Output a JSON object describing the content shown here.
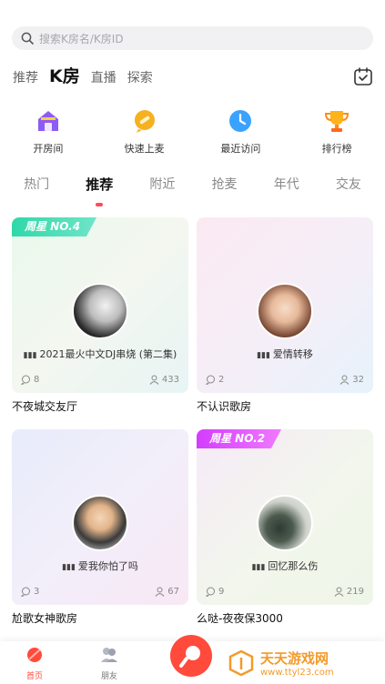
{
  "search": {
    "placeholder": "搜索K房名/K房ID"
  },
  "top_tabs": [
    "推荐",
    "K房",
    "直播",
    "探索"
  ],
  "quick_actions": [
    {
      "label": "开房间",
      "icon": "house-icon",
      "color": "#8e5cf5"
    },
    {
      "label": "快速上麦",
      "icon": "mic-bubble-icon",
      "color": "#f5b120"
    },
    {
      "label": "最近访问",
      "icon": "clock-icon",
      "color": "#3aa2ff"
    },
    {
      "label": "排行榜",
      "icon": "trophy-icon",
      "color": "#ffb31a"
    }
  ],
  "categories": [
    "热门",
    "推荐",
    "附近",
    "抢麦",
    "年代",
    "交友"
  ],
  "rooms": [
    {
      "name": "不夜城交友厅",
      "song": "2021最火中文DJ串烧 (第二集)",
      "comments": "8",
      "listeners": "433",
      "badge": "周星 NO.4"
    },
    {
      "name": "不认识歌房",
      "song": "爱情转移",
      "comments": "2",
      "listeners": "32",
      "badge": ""
    },
    {
      "name": "尬歌女神歌房",
      "song": "爱我你怕了吗",
      "comments": "3",
      "listeners": "67",
      "badge": ""
    },
    {
      "name": "么哒-夜夜保3000",
      "song": "回忆那么伤",
      "comments": "9",
      "listeners": "219",
      "badge": "周星 NO.2"
    }
  ],
  "bottom_tabs": [
    {
      "label": "首页",
      "icon": "home-icon"
    },
    {
      "label": "朋友",
      "icon": "friends-icon"
    }
  ],
  "watermark": {
    "title": "天天游戏网",
    "url": "www.ttyl23.com"
  },
  "colors": {
    "accent": "#ff4a5a",
    "badge_green": "#33d0b0",
    "badge_pink": "#e24dff"
  }
}
